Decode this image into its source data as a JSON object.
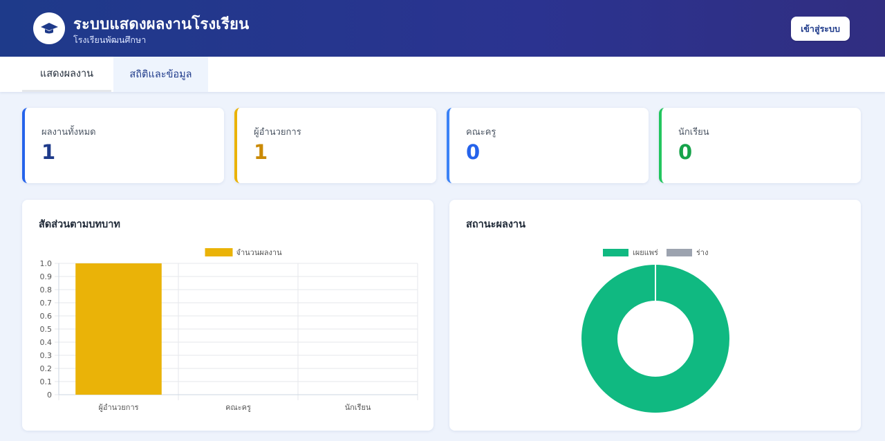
{
  "header": {
    "title": "ระบบแสดงผลงานโรงเรียน",
    "subtitle": "โรงเรียนพัฒนศึกษา",
    "login_label": "เข้าสู่ระบบ",
    "logo_icon": "graduation-cap-icon"
  },
  "tabs": [
    {
      "label": "แสดงผลงาน",
      "active": true
    },
    {
      "label": "สถิติและข้อมูล",
      "active": false
    }
  ],
  "stats": [
    {
      "label": "ผลงานทั้งหมด",
      "value": "1",
      "color": "#1e3a8a"
    },
    {
      "label": "ผู้อำนวยการ",
      "value": "1",
      "color": "#ca8a04"
    },
    {
      "label": "คณะครู",
      "value": "0",
      "color": "#2563eb"
    },
    {
      "label": "นักเรียน",
      "value": "0",
      "color": "#16a34a"
    }
  ],
  "charts": {
    "role_title": "สัดส่วนตามบทบาท",
    "status_title": "สถานะผลงาน"
  },
  "chart_data": [
    {
      "type": "bar",
      "categories": [
        "ผู้อำนวยการ",
        "คณะครู",
        "นักเรียน"
      ],
      "series": [
        {
          "name": "จำนวนผลงาน",
          "values": [
            1,
            0,
            0
          ],
          "color": "#eab308"
        }
      ],
      "yticks": [
        "0",
        "0.1",
        "0.2",
        "0.3",
        "0.4",
        "0.5",
        "0.6",
        "0.7",
        "0.8",
        "0.9",
        "1.0"
      ],
      "ylim": [
        0,
        1
      ],
      "grid": true,
      "legend": "top-center"
    },
    {
      "type": "pie",
      "variant": "doughnut",
      "labels": [
        "เผยแพร่",
        "ร่าง"
      ],
      "values": [
        1,
        0
      ],
      "colors": [
        "#10b981",
        "#9ca3af"
      ],
      "legend": "top-center"
    }
  ]
}
